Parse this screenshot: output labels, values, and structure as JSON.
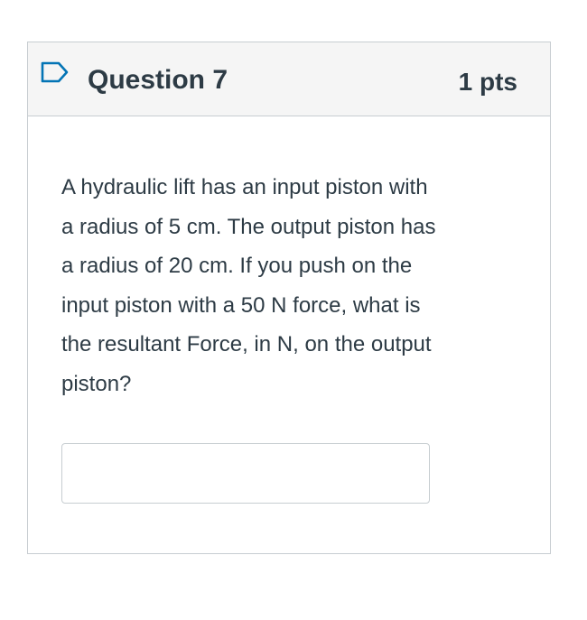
{
  "question": {
    "title": "Question 7",
    "points": "1 pts",
    "flag_icon": "flag-outline-icon",
    "text_lines": [
      "A hydraulic lift has an input piston with",
      "a radius of 5 cm.  The output piston has",
      "a radius of 20 cm.  If you push on the",
      "input piston with a 50 N force, what is",
      "the resultant Force, in N, on the output",
      "piston?"
    ],
    "answer": {
      "value": "",
      "placeholder": ""
    }
  },
  "colors": {
    "header_bg": "#f5f5f5",
    "border": "#c7cdd1",
    "text": "#2d3b45",
    "flag_stroke": "#0374b5"
  }
}
